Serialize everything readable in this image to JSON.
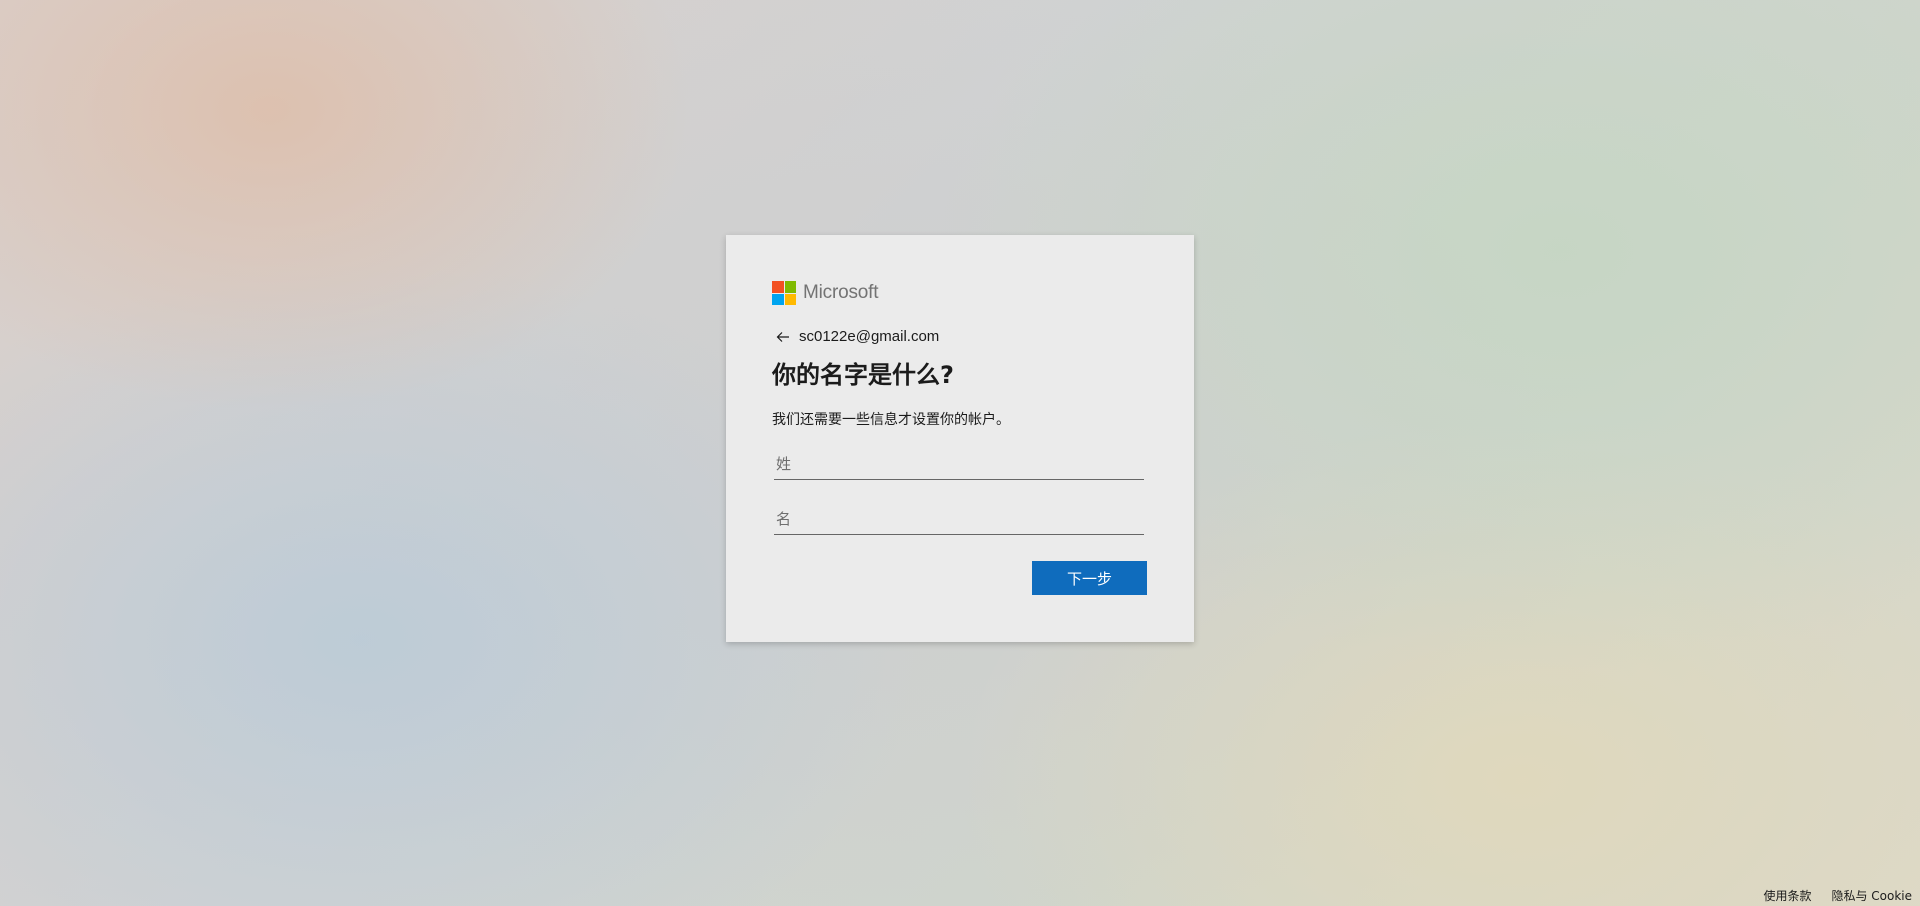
{
  "brand": {
    "name": "Microsoft",
    "colors": [
      "#f25022",
      "#7fba00",
      "#00a4ef",
      "#ffb900"
    ]
  },
  "identity": {
    "email": "sc0122e@gmail.com",
    "back_icon": "arrow-left-icon"
  },
  "form": {
    "title": "你的名字是什么?",
    "description": "我们还需要一些信息才设置你的帐户。",
    "last_name_placeholder": "姓",
    "first_name_placeholder": "名",
    "next_label": "下一步"
  },
  "footer": {
    "terms": "使用条款",
    "privacy": "隐私与 Cookie"
  },
  "colors": {
    "accent": "#0f6cbd",
    "card": "#ebebeb"
  }
}
